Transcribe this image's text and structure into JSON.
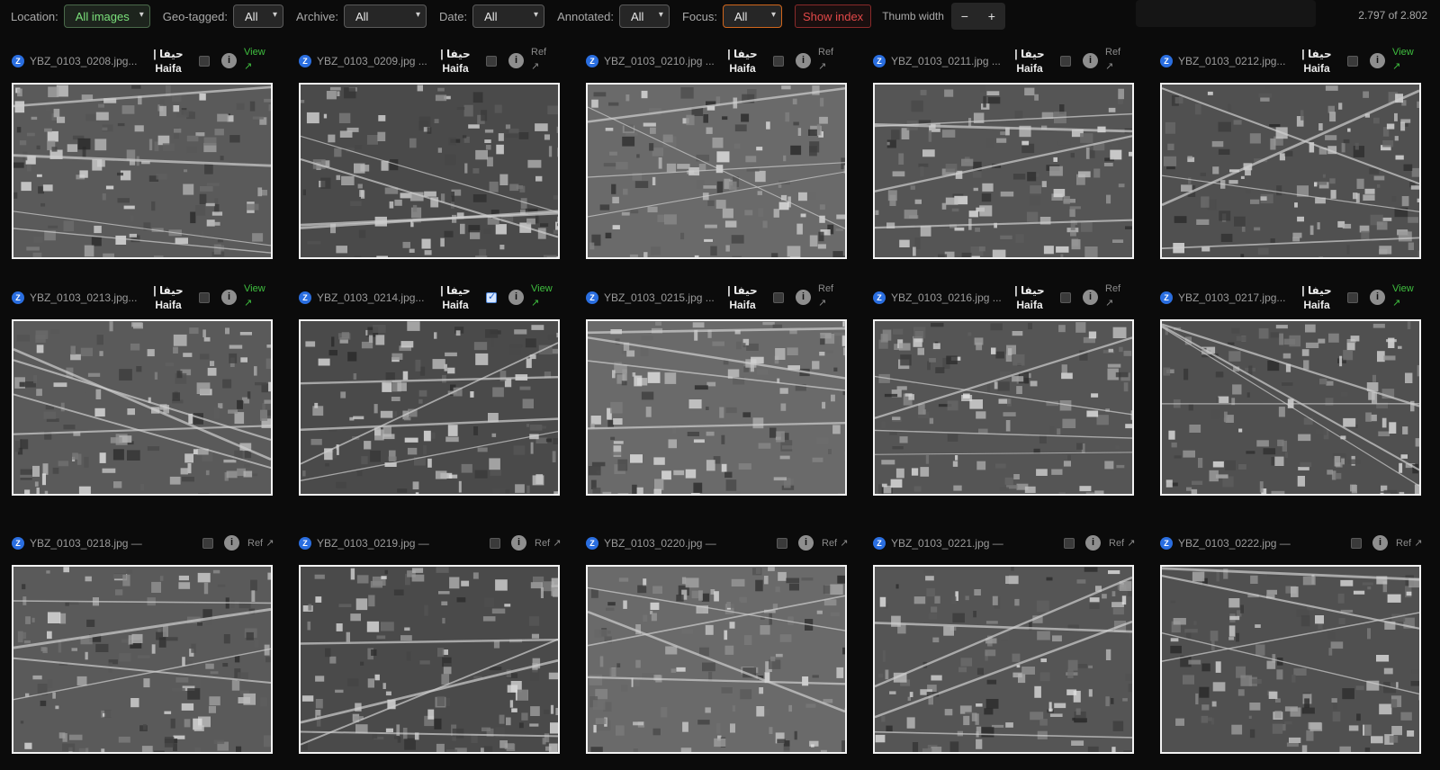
{
  "toolbar": {
    "location_label": "Location:",
    "location_value": "All images",
    "geotagged_label": "Geo-tagged:",
    "geotagged_value": "All",
    "archive_label": "Archive:",
    "archive_value": "All",
    "date_label": "Date:",
    "date_value": "All",
    "annotated_label": "Annotated:",
    "annotated_value": "All",
    "focus_label": "Focus:",
    "focus_value": "All",
    "show_index": "Show index",
    "thumb_width_label": "Thumb width",
    "minus": "−",
    "plus": "+",
    "count": "2.797 of 2.802"
  },
  "cards": [
    {
      "file": "YBZ_0103_0208.jpg...",
      "loc": "| حيفا",
      "loc2": "Haifa",
      "link": "View",
      "checked": false
    },
    {
      "file": "YBZ_0103_0209.jpg ...",
      "loc": "| حيفا",
      "loc2": "Haifa",
      "link": "Ref",
      "checked": false
    },
    {
      "file": "YBZ_0103_0210.jpg ...",
      "loc": "| حيفا",
      "loc2": "Haifa",
      "link": "Ref",
      "checked": false
    },
    {
      "file": "YBZ_0103_0211.jpg ...",
      "loc": "| حيفا",
      "loc2": "Haifa",
      "link": "Ref",
      "checked": false
    },
    {
      "file": "YBZ_0103_0212.jpg...",
      "loc": "| حيفا",
      "loc2": "Haifa",
      "link": "View",
      "checked": false
    },
    {
      "file": "YBZ_0103_0213.jpg...",
      "loc": "| حيفا",
      "loc2": "Haifa",
      "link": "View",
      "checked": false
    },
    {
      "file": "YBZ_0103_0214.jpg...",
      "loc": "| حيفا",
      "loc2": "Haifa",
      "link": "View",
      "checked": true
    },
    {
      "file": "YBZ_0103_0215.jpg ...",
      "loc": "| حيفا",
      "loc2": "Haifa",
      "link": "Ref",
      "checked": false
    },
    {
      "file": "YBZ_0103_0216.jpg ...",
      "loc": "| حيفا",
      "loc2": "Haifa",
      "link": "Ref",
      "checked": false
    },
    {
      "file": "YBZ_0103_0217.jpg...",
      "loc": "| حيفا",
      "loc2": "Haifa",
      "link": "View",
      "checked": false
    },
    {
      "file": "YBZ_0103_0218.jpg —",
      "loc": "",
      "loc2": "",
      "link": "Ref",
      "checked": false
    },
    {
      "file": "YBZ_0103_0219.jpg —",
      "loc": "",
      "loc2": "",
      "link": "Ref",
      "checked": false
    },
    {
      "file": "YBZ_0103_0220.jpg —",
      "loc": "",
      "loc2": "",
      "link": "Ref",
      "checked": false
    },
    {
      "file": "YBZ_0103_0221.jpg —",
      "loc": "",
      "loc2": "",
      "link": "Ref",
      "checked": false
    },
    {
      "file": "YBZ_0103_0222.jpg —",
      "loc": "",
      "loc2": "",
      "link": "Ref",
      "checked": false
    }
  ],
  "icons": {
    "badge_letter": "Z",
    "info_letter": "i",
    "arrow": "↗",
    "chevron": "⌄"
  },
  "colors": {
    "accent_green": "#3fbf3f",
    "badge_blue": "#2a6ee0",
    "focus_orange": "#d0661c",
    "index_red": "#e04848"
  }
}
